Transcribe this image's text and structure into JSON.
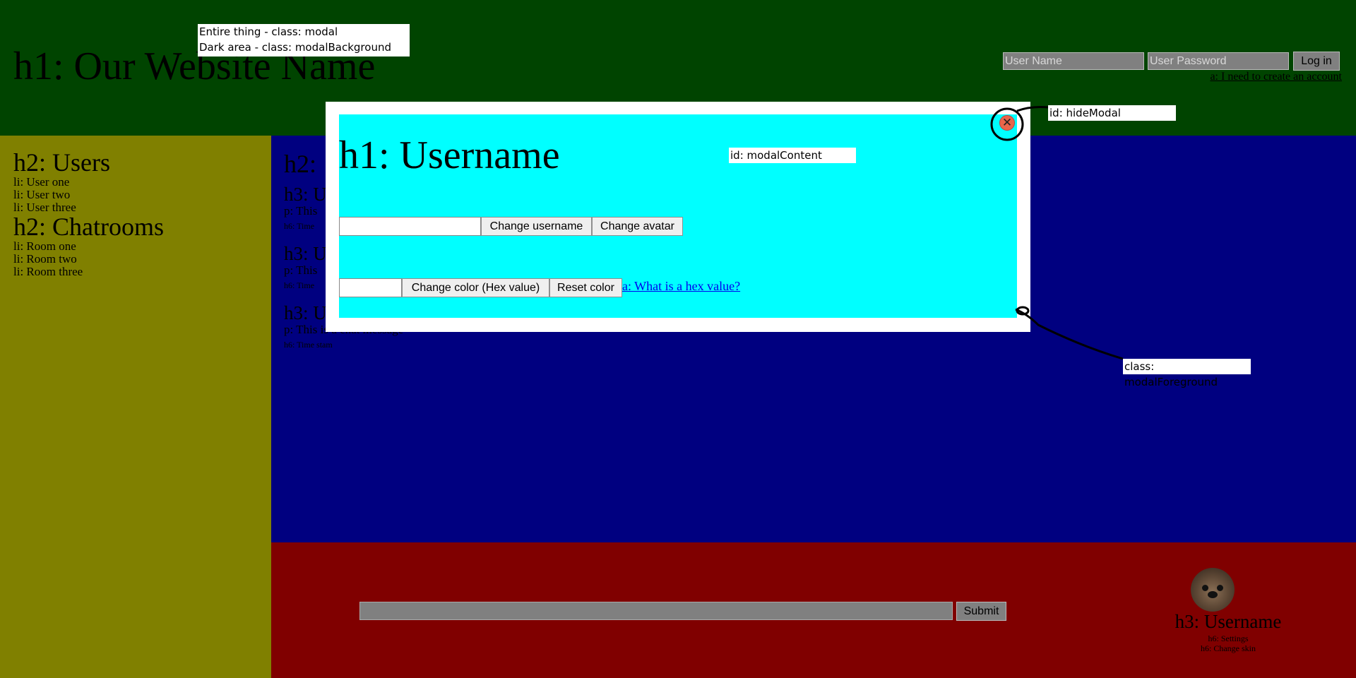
{
  "header": {
    "title": "h1: Our Website Name",
    "username_placeholder": "User Name",
    "password_placeholder": "User Password",
    "login_label": "Log in",
    "account_link": "a: I need to create an account"
  },
  "sidebar": {
    "users_heading": "h2: Users",
    "users": [
      "li: User one",
      "li: User two",
      "li: User three"
    ],
    "rooms_heading": "h2: Chatrooms",
    "rooms": [
      "li: Room one",
      "li: Room two",
      "li: Room three"
    ]
  },
  "main": {
    "heading": "h2:",
    "messages": [
      {
        "user": "h3: U",
        "text": "p: This",
        "time": "h6: Time"
      },
      {
        "user": "h3: U",
        "text": "p: This",
        "time": "h6: Time"
      },
      {
        "user": "h3: U",
        "text": "p: This is a chat message",
        "time": "h6: Time stam"
      }
    ]
  },
  "footer": {
    "submit_label": "Submit",
    "username": "h3: Username",
    "settings": "h6: Settings",
    "change_skin": "h6: Change skin"
  },
  "modal": {
    "title": "h1: Username",
    "change_username_label": "Change username",
    "change_avatar_label": "Change avatar",
    "change_color_label": "Change color (Hex value)",
    "reset_color_label": "Reset color",
    "hex_link": "a: What is a hex value?",
    "close_icon": "close-x-icon"
  },
  "annotations": {
    "modal_line1": "Entire thing - class: modal",
    "modal_line2": "Dark area - class: modalBackground",
    "hide_modal": "id: hideModal",
    "modal_content": "id: modalContent",
    "modal_foreground": "class: modalForeground"
  },
  "colors": {
    "header": "#004400",
    "sidebar": "#808000",
    "main": "#000080",
    "footer": "#800000",
    "modal_content": "#00ffff",
    "link": "#0000ee"
  }
}
